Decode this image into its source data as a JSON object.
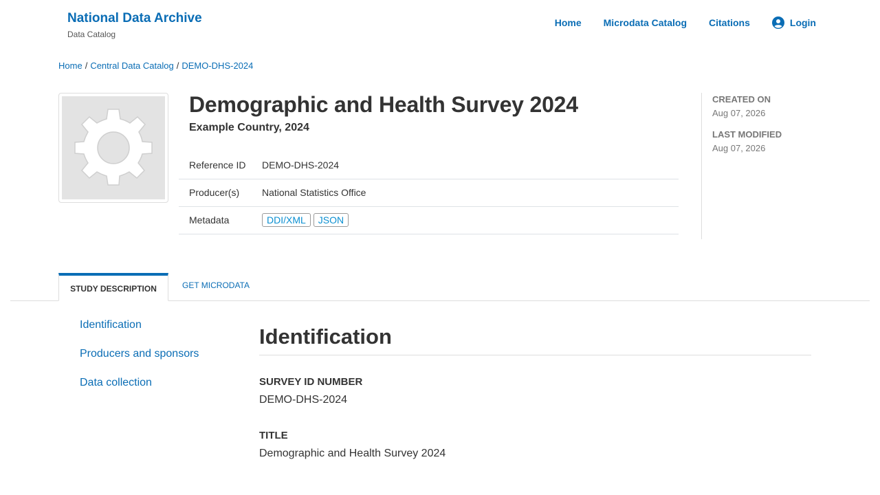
{
  "header": {
    "brand_title": "National Data Archive",
    "brand_subtitle": "Data Catalog",
    "nav": {
      "home": "Home",
      "microdata_catalog": "Microdata Catalog",
      "citations": "Citations",
      "login": "Login"
    }
  },
  "breadcrumb": {
    "home": "Home",
    "catalog": "Central Data Catalog",
    "current": "DEMO-DHS-2024",
    "separator": "/"
  },
  "study": {
    "title": "Demographic and Health Survey 2024",
    "subtitle": "Example Country, 2024",
    "thumbnail_icon": "gear-icon",
    "table": {
      "reference_label": "Reference ID",
      "reference_value": "DEMO-DHS-2024",
      "producers_label": "Producer(s)",
      "producers_value": "National Statistics Office",
      "metadata_label": "Metadata",
      "metadata_ddi": "DDI/XML",
      "metadata_json": "JSON"
    },
    "side": {
      "created_label": "CREATED ON",
      "created_value": "Aug 07, 2026",
      "modified_label": "LAST MODIFIED",
      "modified_value": "Aug 07, 2026"
    }
  },
  "tabs": {
    "study_description": "STUDY DESCRIPTION",
    "get_microdata": "GET MICRODATA"
  },
  "section_nav": {
    "identification": "Identification",
    "producers": "Producers and sponsors",
    "data_collection": "Data collection"
  },
  "content": {
    "heading": "Identification",
    "survey_id_label": "SURVEY ID NUMBER",
    "survey_id_value": "DEMO-DHS-2024",
    "title_label": "TITLE",
    "title_value": "Demographic and Health Survey 2024"
  },
  "colors": {
    "accent": "#0a6db5",
    "badge_text": "#0a8fd1",
    "muted": "#777777"
  }
}
